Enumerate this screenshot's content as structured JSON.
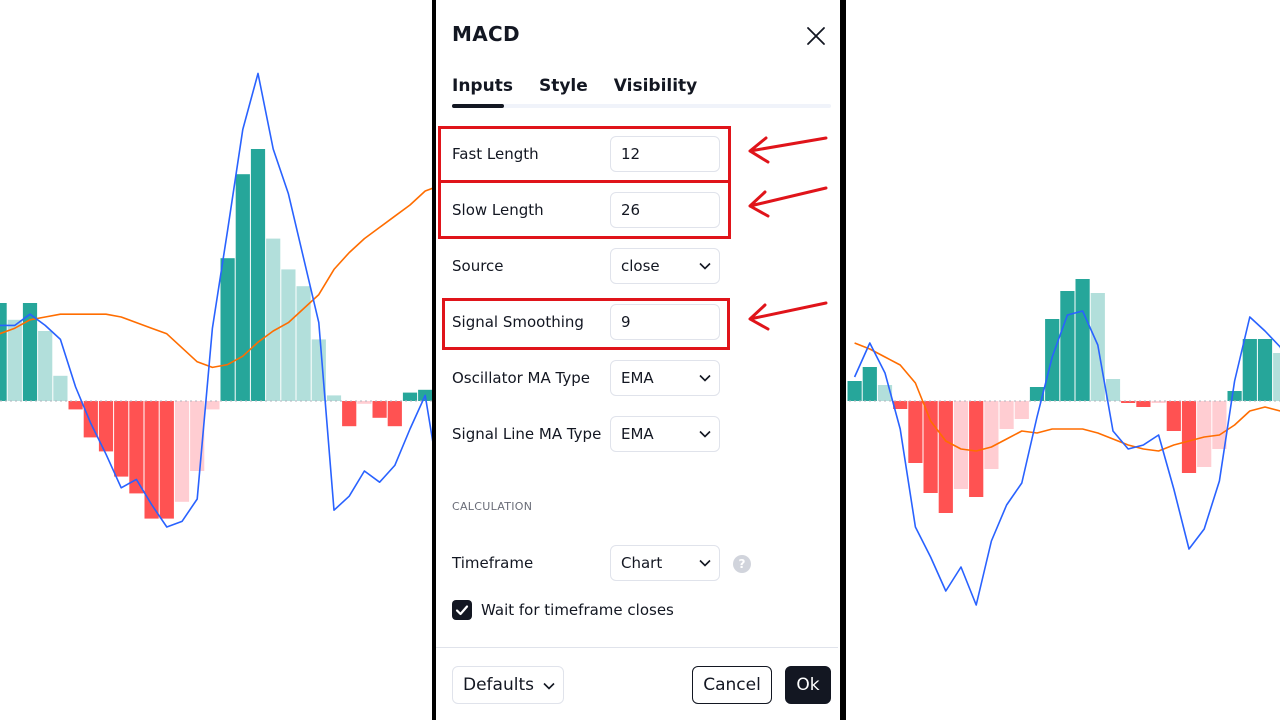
{
  "dialog": {
    "title": "MACD",
    "tabs": [
      {
        "label": "Inputs",
        "active": true
      },
      {
        "label": "Style",
        "active": false
      },
      {
        "label": "Visibility",
        "active": false
      }
    ],
    "inputs": [
      {
        "label": "Fast Length",
        "value": "12",
        "type": "number"
      },
      {
        "label": "Slow Length",
        "value": "26",
        "type": "number"
      },
      {
        "label": "Source",
        "value": "close",
        "type": "select"
      },
      {
        "label": "Signal Smoothing",
        "value": "9",
        "type": "number"
      },
      {
        "label": "Oscillator MA Type",
        "value": "EMA",
        "type": "select"
      },
      {
        "label": "Signal Line MA Type",
        "value": "EMA",
        "type": "select"
      }
    ],
    "calculation_section": "CALCULATION",
    "timeframe": {
      "label": "Timeframe",
      "value": "Chart",
      "help": "?"
    },
    "wait_checkbox": {
      "label": "Wait for timeframe closes",
      "checked": true
    },
    "footer": {
      "defaults": "Defaults",
      "cancel": "Cancel",
      "ok": "Ok"
    }
  },
  "colors": {
    "hist_up_strong": "#26a69a",
    "hist_up_weak": "#b2dfdb",
    "hist_down_strong": "#ff5252",
    "hist_down_weak": "#ffcdd2",
    "macd_line": "#2962ff",
    "signal_line": "#ff6d00",
    "annotation_red": "#e0141a",
    "dark": "#131722"
  },
  "chart_data": [
    {
      "type": "bar",
      "title": "",
      "zero": 0,
      "histogram": [
        35,
        29,
        35,
        25,
        9,
        -3,
        -13,
        -18,
        -27,
        -33,
        -42,
        -42,
        -36,
        -25,
        -3,
        51,
        81,
        90,
        58,
        47,
        41,
        22,
        2,
        -9,
        -1,
        -6,
        -9,
        3,
        4,
        -11,
        6,
        -2
      ],
      "macd": [
        27,
        27,
        31,
        27,
        22,
        5,
        -8,
        -19,
        -31,
        -28,
        -37,
        -45,
        -43,
        -35,
        26,
        61,
        97,
        117,
        90,
        74,
        51,
        28,
        -39,
        -34,
        -25,
        -29,
        -23,
        -10,
        2,
        -31,
        -18,
        -10
      ],
      "signal": [
        24,
        26,
        29,
        30,
        31,
        31,
        31,
        31,
        30,
        28,
        26,
        24,
        19,
        14,
        12,
        13,
        16,
        21,
        25,
        28,
        33,
        38,
        47,
        53,
        58,
        62,
        66,
        70,
        75,
        77,
        79,
        81
      ]
    },
    {
      "type": "bar",
      "title": "",
      "zero": 0,
      "histogram": [
        10,
        17,
        8,
        -4,
        -31,
        -46,
        -56,
        -44,
        -48,
        -34,
        -14,
        -9,
        7,
        41,
        55,
        61,
        54,
        11,
        -1,
        -3,
        -1,
        -15,
        -36,
        -33,
        -24,
        5,
        31,
        31,
        24,
        11
      ],
      "macd": [
        12,
        29,
        14,
        -14,
        -63,
        -78,
        -95,
        -83,
        -102,
        -70,
        -52,
        -41,
        -8,
        22,
        43,
        45,
        28,
        -15,
        -24,
        -22,
        -17,
        -44,
        -74,
        -64,
        -40,
        10,
        42,
        35,
        27,
        11
      ],
      "signal": [
        29,
        26,
        22,
        18,
        9,
        -10,
        -20,
        -24,
        -25,
        -23,
        -19,
        -15,
        -16,
        -14,
        -14,
        -14,
        -16,
        -19,
        -22,
        -24,
        -25,
        -22,
        -20,
        -18,
        -17,
        -12,
        -5,
        -3,
        -5,
        -6
      ]
    }
  ]
}
